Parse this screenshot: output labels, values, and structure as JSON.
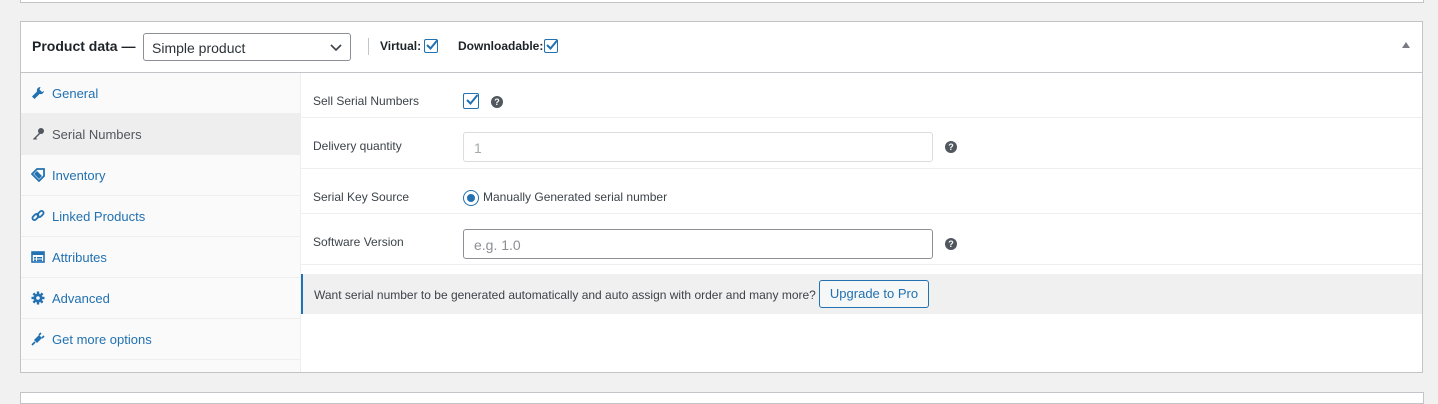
{
  "header": {
    "title": "Product data",
    "dash": "—",
    "product_type": "Simple product",
    "virtual_label": "Virtual:",
    "virtual_checked": true,
    "downloadable_label": "Downloadable:",
    "downloadable_checked": true
  },
  "tabs": [
    {
      "label": "General",
      "icon": "wrench-icon",
      "active": false
    },
    {
      "label": "Serial Numbers",
      "icon": "key-icon",
      "active": true
    },
    {
      "label": "Inventory",
      "icon": "tag-icon",
      "active": false
    },
    {
      "label": "Linked Products",
      "icon": "link-icon",
      "active": false
    },
    {
      "label": "Attributes",
      "icon": "list-icon",
      "active": false
    },
    {
      "label": "Advanced",
      "icon": "gear-icon",
      "active": false
    },
    {
      "label": "Get more options",
      "icon": "plugin-icon",
      "active": false
    }
  ],
  "fields": {
    "sell_serial_label": "Sell Serial Numbers",
    "sell_serial_checked": true,
    "delivery_qty_label": "Delivery quantity",
    "delivery_qty_value": "1",
    "key_source_label": "Serial Key Source",
    "key_source_option": "Manually Generated serial number",
    "software_version_label": "Software Version",
    "software_version_placeholder": "e.g. 1.0"
  },
  "notice": {
    "text": "Want serial number to be generated automatically and auto assign with order and many more?",
    "button": "Upgrade to Pro"
  },
  "help_glyph": "?",
  "colors": {
    "accent": "#2271b1",
    "tab_active_bg": "#eeeeee"
  }
}
